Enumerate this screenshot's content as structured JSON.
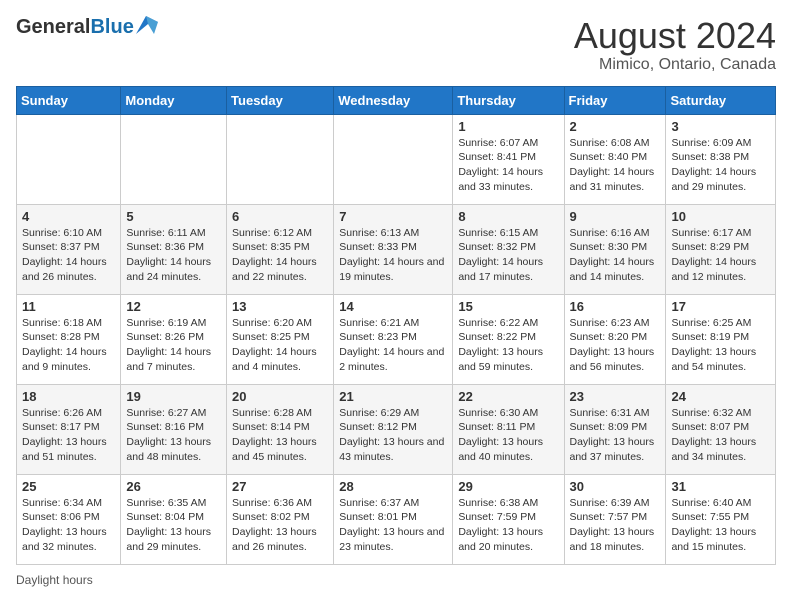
{
  "header": {
    "logo_general": "General",
    "logo_blue": "Blue",
    "main_title": "August 2024",
    "subtitle": "Mimico, Ontario, Canada"
  },
  "days_of_week": [
    "Sunday",
    "Monday",
    "Tuesday",
    "Wednesday",
    "Thursday",
    "Friday",
    "Saturday"
  ],
  "footer": {
    "daylight_label": "Daylight hours"
  },
  "weeks": [
    {
      "days": [
        {
          "num": "",
          "info": ""
        },
        {
          "num": "",
          "info": ""
        },
        {
          "num": "",
          "info": ""
        },
        {
          "num": "",
          "info": ""
        },
        {
          "num": "1",
          "info": "Sunrise: 6:07 AM\nSunset: 8:41 PM\nDaylight: 14 hours and 33 minutes."
        },
        {
          "num": "2",
          "info": "Sunrise: 6:08 AM\nSunset: 8:40 PM\nDaylight: 14 hours and 31 minutes."
        },
        {
          "num": "3",
          "info": "Sunrise: 6:09 AM\nSunset: 8:38 PM\nDaylight: 14 hours and 29 minutes."
        }
      ]
    },
    {
      "days": [
        {
          "num": "4",
          "info": "Sunrise: 6:10 AM\nSunset: 8:37 PM\nDaylight: 14 hours and 26 minutes."
        },
        {
          "num": "5",
          "info": "Sunrise: 6:11 AM\nSunset: 8:36 PM\nDaylight: 14 hours and 24 minutes."
        },
        {
          "num": "6",
          "info": "Sunrise: 6:12 AM\nSunset: 8:35 PM\nDaylight: 14 hours and 22 minutes."
        },
        {
          "num": "7",
          "info": "Sunrise: 6:13 AM\nSunset: 8:33 PM\nDaylight: 14 hours and 19 minutes."
        },
        {
          "num": "8",
          "info": "Sunrise: 6:15 AM\nSunset: 8:32 PM\nDaylight: 14 hours and 17 minutes."
        },
        {
          "num": "9",
          "info": "Sunrise: 6:16 AM\nSunset: 8:30 PM\nDaylight: 14 hours and 14 minutes."
        },
        {
          "num": "10",
          "info": "Sunrise: 6:17 AM\nSunset: 8:29 PM\nDaylight: 14 hours and 12 minutes."
        }
      ]
    },
    {
      "days": [
        {
          "num": "11",
          "info": "Sunrise: 6:18 AM\nSunset: 8:28 PM\nDaylight: 14 hours and 9 minutes."
        },
        {
          "num": "12",
          "info": "Sunrise: 6:19 AM\nSunset: 8:26 PM\nDaylight: 14 hours and 7 minutes."
        },
        {
          "num": "13",
          "info": "Sunrise: 6:20 AM\nSunset: 8:25 PM\nDaylight: 14 hours and 4 minutes."
        },
        {
          "num": "14",
          "info": "Sunrise: 6:21 AM\nSunset: 8:23 PM\nDaylight: 14 hours and 2 minutes."
        },
        {
          "num": "15",
          "info": "Sunrise: 6:22 AM\nSunset: 8:22 PM\nDaylight: 13 hours and 59 minutes."
        },
        {
          "num": "16",
          "info": "Sunrise: 6:23 AM\nSunset: 8:20 PM\nDaylight: 13 hours and 56 minutes."
        },
        {
          "num": "17",
          "info": "Sunrise: 6:25 AM\nSunset: 8:19 PM\nDaylight: 13 hours and 54 minutes."
        }
      ]
    },
    {
      "days": [
        {
          "num": "18",
          "info": "Sunrise: 6:26 AM\nSunset: 8:17 PM\nDaylight: 13 hours and 51 minutes."
        },
        {
          "num": "19",
          "info": "Sunrise: 6:27 AM\nSunset: 8:16 PM\nDaylight: 13 hours and 48 minutes."
        },
        {
          "num": "20",
          "info": "Sunrise: 6:28 AM\nSunset: 8:14 PM\nDaylight: 13 hours and 45 minutes."
        },
        {
          "num": "21",
          "info": "Sunrise: 6:29 AM\nSunset: 8:12 PM\nDaylight: 13 hours and 43 minutes."
        },
        {
          "num": "22",
          "info": "Sunrise: 6:30 AM\nSunset: 8:11 PM\nDaylight: 13 hours and 40 minutes."
        },
        {
          "num": "23",
          "info": "Sunrise: 6:31 AM\nSunset: 8:09 PM\nDaylight: 13 hours and 37 minutes."
        },
        {
          "num": "24",
          "info": "Sunrise: 6:32 AM\nSunset: 8:07 PM\nDaylight: 13 hours and 34 minutes."
        }
      ]
    },
    {
      "days": [
        {
          "num": "25",
          "info": "Sunrise: 6:34 AM\nSunset: 8:06 PM\nDaylight: 13 hours and 32 minutes."
        },
        {
          "num": "26",
          "info": "Sunrise: 6:35 AM\nSunset: 8:04 PM\nDaylight: 13 hours and 29 minutes."
        },
        {
          "num": "27",
          "info": "Sunrise: 6:36 AM\nSunset: 8:02 PM\nDaylight: 13 hours and 26 minutes."
        },
        {
          "num": "28",
          "info": "Sunrise: 6:37 AM\nSunset: 8:01 PM\nDaylight: 13 hours and 23 minutes."
        },
        {
          "num": "29",
          "info": "Sunrise: 6:38 AM\nSunset: 7:59 PM\nDaylight: 13 hours and 20 minutes."
        },
        {
          "num": "30",
          "info": "Sunrise: 6:39 AM\nSunset: 7:57 PM\nDaylight: 13 hours and 18 minutes."
        },
        {
          "num": "31",
          "info": "Sunrise: 6:40 AM\nSunset: 7:55 PM\nDaylight: 13 hours and 15 minutes."
        }
      ]
    }
  ]
}
